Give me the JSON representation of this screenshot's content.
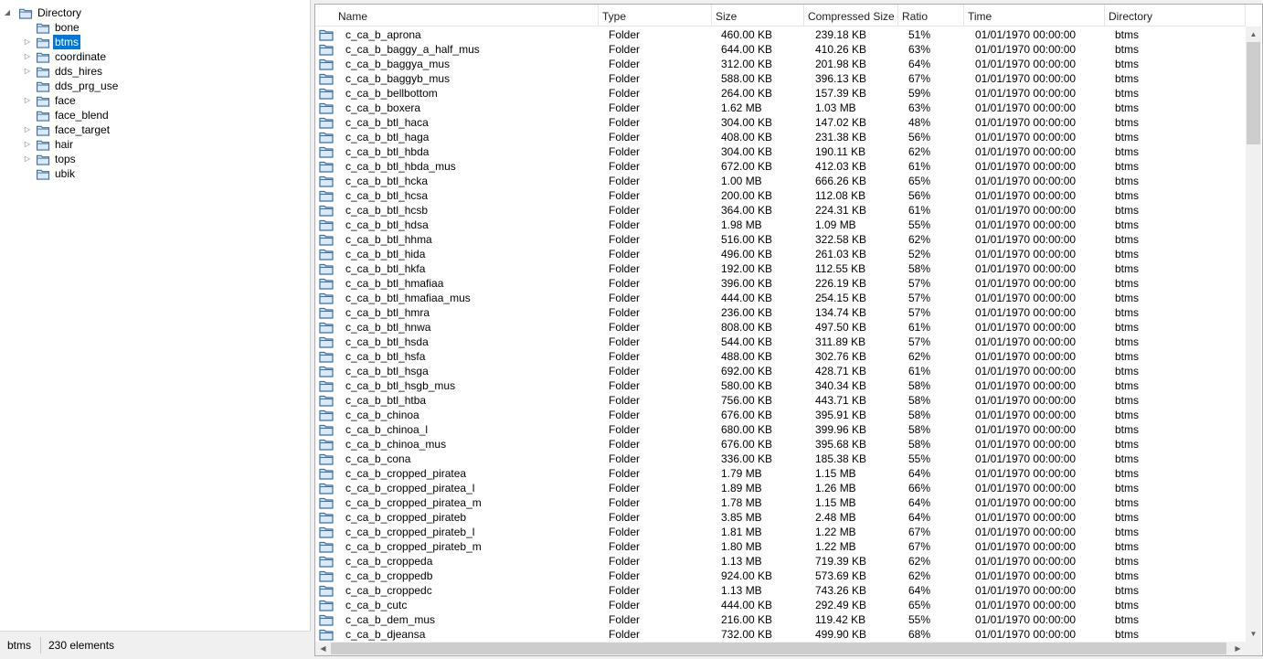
{
  "tree": {
    "root": {
      "label": "Directory",
      "expanded": true
    },
    "items": [
      {
        "label": "bone",
        "has_children": false,
        "selected": false
      },
      {
        "label": "btms",
        "has_children": true,
        "selected": true
      },
      {
        "label": "coordinate",
        "has_children": true,
        "selected": false
      },
      {
        "label": "dds_hires",
        "has_children": true,
        "selected": false
      },
      {
        "label": "dds_prg_use",
        "has_children": false,
        "selected": false
      },
      {
        "label": "face",
        "has_children": true,
        "selected": false
      },
      {
        "label": "face_blend",
        "has_children": false,
        "selected": false
      },
      {
        "label": "face_target",
        "has_children": true,
        "selected": false
      },
      {
        "label": "hair",
        "has_children": true,
        "selected": false
      },
      {
        "label": "tops",
        "has_children": true,
        "selected": false
      },
      {
        "label": "ubik",
        "has_children": false,
        "selected": false
      }
    ]
  },
  "status": {
    "path": "btms",
    "count": "230 elements"
  },
  "list": {
    "columns": [
      "Name",
      "Type",
      "Size",
      "Compressed Size",
      "Ratio",
      "Time",
      "Directory"
    ],
    "rows": [
      [
        "c_ca_b_aprona",
        "Folder",
        "460.00 KB",
        "239.18 KB",
        "51%",
        "01/01/1970 00:00:00",
        "btms"
      ],
      [
        "c_ca_b_baggy_a_half_mus",
        "Folder",
        "644.00 KB",
        "410.26 KB",
        "63%",
        "01/01/1970 00:00:00",
        "btms"
      ],
      [
        "c_ca_b_baggya_mus",
        "Folder",
        "312.00 KB",
        "201.98 KB",
        "64%",
        "01/01/1970 00:00:00",
        "btms"
      ],
      [
        "c_ca_b_baggyb_mus",
        "Folder",
        "588.00 KB",
        "396.13 KB",
        "67%",
        "01/01/1970 00:00:00",
        "btms"
      ],
      [
        "c_ca_b_bellbottom",
        "Folder",
        "264.00 KB",
        "157.39 KB",
        "59%",
        "01/01/1970 00:00:00",
        "btms"
      ],
      [
        "c_ca_b_boxera",
        "Folder",
        "1.62 MB",
        "1.03 MB",
        "63%",
        "01/01/1970 00:00:00",
        "btms"
      ],
      [
        "c_ca_b_btl_haca",
        "Folder",
        "304.00 KB",
        "147.02 KB",
        "48%",
        "01/01/1970 00:00:00",
        "btms"
      ],
      [
        "c_ca_b_btl_haga",
        "Folder",
        "408.00 KB",
        "231.38 KB",
        "56%",
        "01/01/1970 00:00:00",
        "btms"
      ],
      [
        "c_ca_b_btl_hbda",
        "Folder",
        "304.00 KB",
        "190.11 KB",
        "62%",
        "01/01/1970 00:00:00",
        "btms"
      ],
      [
        "c_ca_b_btl_hbda_mus",
        "Folder",
        "672.00 KB",
        "412.03 KB",
        "61%",
        "01/01/1970 00:00:00",
        "btms"
      ],
      [
        "c_ca_b_btl_hcka",
        "Folder",
        "1.00 MB",
        "666.26 KB",
        "65%",
        "01/01/1970 00:00:00",
        "btms"
      ],
      [
        "c_ca_b_btl_hcsa",
        "Folder",
        "200.00 KB",
        "112.08 KB",
        "56%",
        "01/01/1970 00:00:00",
        "btms"
      ],
      [
        "c_ca_b_btl_hcsb",
        "Folder",
        "364.00 KB",
        "224.31 KB",
        "61%",
        "01/01/1970 00:00:00",
        "btms"
      ],
      [
        "c_ca_b_btl_hdsa",
        "Folder",
        "1.98 MB",
        "1.09 MB",
        "55%",
        "01/01/1970 00:00:00",
        "btms"
      ],
      [
        "c_ca_b_btl_hhma",
        "Folder",
        "516.00 KB",
        "322.58 KB",
        "62%",
        "01/01/1970 00:00:00",
        "btms"
      ],
      [
        "c_ca_b_btl_hida",
        "Folder",
        "496.00 KB",
        "261.03 KB",
        "52%",
        "01/01/1970 00:00:00",
        "btms"
      ],
      [
        "c_ca_b_btl_hkfa",
        "Folder",
        "192.00 KB",
        "112.55 KB",
        "58%",
        "01/01/1970 00:00:00",
        "btms"
      ],
      [
        "c_ca_b_btl_hmafiaa",
        "Folder",
        "396.00 KB",
        "226.19 KB",
        "57%",
        "01/01/1970 00:00:00",
        "btms"
      ],
      [
        "c_ca_b_btl_hmafiaa_mus",
        "Folder",
        "444.00 KB",
        "254.15 KB",
        "57%",
        "01/01/1970 00:00:00",
        "btms"
      ],
      [
        "c_ca_b_btl_hmra",
        "Folder",
        "236.00 KB",
        "134.74 KB",
        "57%",
        "01/01/1970 00:00:00",
        "btms"
      ],
      [
        "c_ca_b_btl_hnwa",
        "Folder",
        "808.00 KB",
        "497.50 KB",
        "61%",
        "01/01/1970 00:00:00",
        "btms"
      ],
      [
        "c_ca_b_btl_hsda",
        "Folder",
        "544.00 KB",
        "311.89 KB",
        "57%",
        "01/01/1970 00:00:00",
        "btms"
      ],
      [
        "c_ca_b_btl_hsfa",
        "Folder",
        "488.00 KB",
        "302.76 KB",
        "62%",
        "01/01/1970 00:00:00",
        "btms"
      ],
      [
        "c_ca_b_btl_hsga",
        "Folder",
        "692.00 KB",
        "428.71 KB",
        "61%",
        "01/01/1970 00:00:00",
        "btms"
      ],
      [
        "c_ca_b_btl_hsgb_mus",
        "Folder",
        "580.00 KB",
        "340.34 KB",
        "58%",
        "01/01/1970 00:00:00",
        "btms"
      ],
      [
        "c_ca_b_btl_htba",
        "Folder",
        "756.00 KB",
        "443.71 KB",
        "58%",
        "01/01/1970 00:00:00",
        "btms"
      ],
      [
        "c_ca_b_chinoa",
        "Folder",
        "676.00 KB",
        "395.91 KB",
        "58%",
        "01/01/1970 00:00:00",
        "btms"
      ],
      [
        "c_ca_b_chinoa_l",
        "Folder",
        "680.00 KB",
        "399.96 KB",
        "58%",
        "01/01/1970 00:00:00",
        "btms"
      ],
      [
        "c_ca_b_chinoa_mus",
        "Folder",
        "676.00 KB",
        "395.68 KB",
        "58%",
        "01/01/1970 00:00:00",
        "btms"
      ],
      [
        "c_ca_b_cona",
        "Folder",
        "336.00 KB",
        "185.38 KB",
        "55%",
        "01/01/1970 00:00:00",
        "btms"
      ],
      [
        "c_ca_b_cropped_piratea",
        "Folder",
        "1.79 MB",
        "1.15 MB",
        "64%",
        "01/01/1970 00:00:00",
        "btms"
      ],
      [
        "c_ca_b_cropped_piratea_l",
        "Folder",
        "1.89 MB",
        "1.26 MB",
        "66%",
        "01/01/1970 00:00:00",
        "btms"
      ],
      [
        "c_ca_b_cropped_piratea_m",
        "Folder",
        "1.78 MB",
        "1.15 MB",
        "64%",
        "01/01/1970 00:00:00",
        "btms"
      ],
      [
        "c_ca_b_cropped_pirateb",
        "Folder",
        "3.85 MB",
        "2.48 MB",
        "64%",
        "01/01/1970 00:00:00",
        "btms"
      ],
      [
        "c_ca_b_cropped_pirateb_l",
        "Folder",
        "1.81 MB",
        "1.22 MB",
        "67%",
        "01/01/1970 00:00:00",
        "btms"
      ],
      [
        "c_ca_b_cropped_pirateb_m",
        "Folder",
        "1.80 MB",
        "1.22 MB",
        "67%",
        "01/01/1970 00:00:00",
        "btms"
      ],
      [
        "c_ca_b_croppeda",
        "Folder",
        "1.13 MB",
        "719.39 KB",
        "62%",
        "01/01/1970 00:00:00",
        "btms"
      ],
      [
        "c_ca_b_croppedb",
        "Folder",
        "924.00 KB",
        "573.69 KB",
        "62%",
        "01/01/1970 00:00:00",
        "btms"
      ],
      [
        "c_ca_b_croppedc",
        "Folder",
        "1.13 MB",
        "743.26 KB",
        "64%",
        "01/01/1970 00:00:00",
        "btms"
      ],
      [
        "c_ca_b_cutc",
        "Folder",
        "444.00 KB",
        "292.49 KB",
        "65%",
        "01/01/1970 00:00:00",
        "btms"
      ],
      [
        "c_ca_b_dem_mus",
        "Folder",
        "216.00 KB",
        "119.42 KB",
        "55%",
        "01/01/1970 00:00:00",
        "btms"
      ],
      [
        "c_ca_b_djeansa",
        "Folder",
        "732.00 KB",
        "499.90 KB",
        "68%",
        "01/01/1970 00:00:00",
        "btms"
      ]
    ]
  },
  "icons": {
    "expand": "triangle-right-icon",
    "collapse": "triangle-down-icon",
    "folder": "folder-icon",
    "scroll_up": "chevron-up-icon",
    "scroll_down": "chevron-down-icon"
  },
  "colors": {
    "selection": "#0078d7",
    "folder_outline": "#3a6ea5",
    "folder_fill": "#dbe8f7"
  }
}
